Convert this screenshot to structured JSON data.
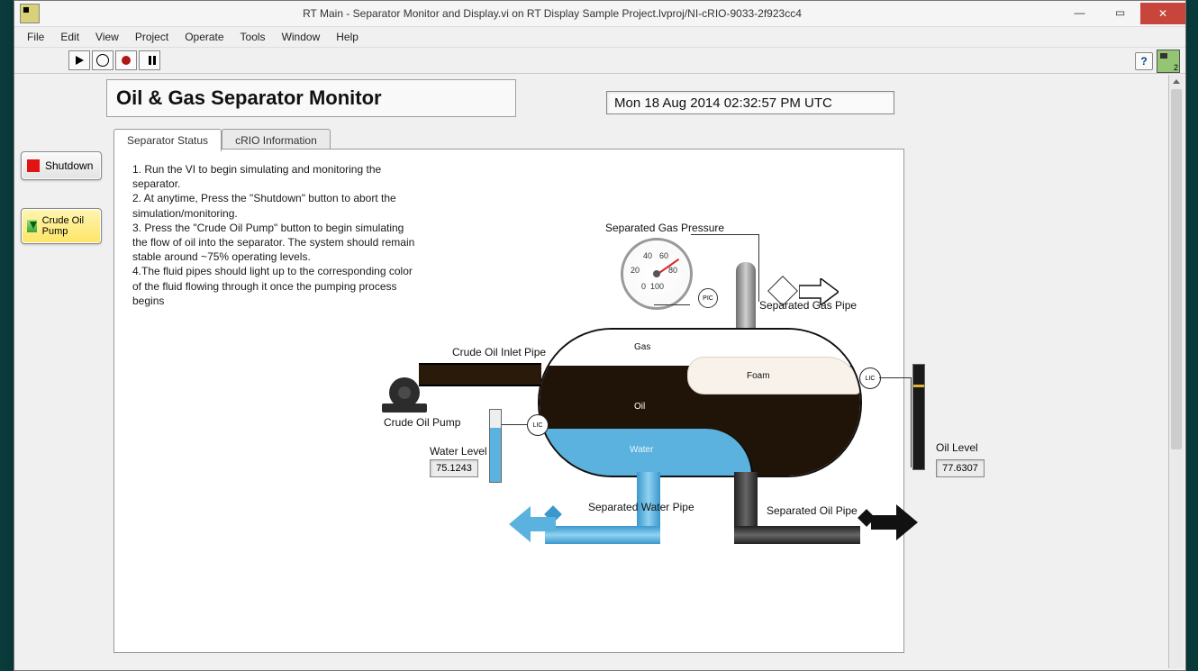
{
  "window": {
    "title": "RT Main - Separator Monitor and Display.vi on RT Display Sample Project.lvproj/NI-cRIO-9033-2f923cc4"
  },
  "menus": [
    "File",
    "Edit",
    "View",
    "Project",
    "Operate",
    "Tools",
    "Window",
    "Help"
  ],
  "header": {
    "title": "Oil & Gas Separator Monitor",
    "timestamp": "Mon 18 Aug 2014 02:32:57 PM UTC"
  },
  "side": {
    "shutdown": "Shutdown",
    "pump": "Crude Oil Pump"
  },
  "tabs": {
    "status": "Separator Status",
    "crio": "cRIO Information"
  },
  "instructions": {
    "l1": "1. Run the VI to begin simulating and monitoring the separator.",
    "l2": "2. At anytime, Press the \"Shutdown\" button to abort the simulation/monitoring.",
    "l3": "3. Press the \"Crude Oil Pump\" button to begin simulating the flow of oil into the separator. The system should remain stable around ~75% operating levels.",
    "l4": "4.The fluid pipes should light up to the corresponding color of the fluid flowing through it once the pumping process begins"
  },
  "diagram": {
    "gauge_label": "Separated Gas Pressure",
    "gauge_ticks": {
      "t0": "0",
      "t20": "20",
      "t40": "40",
      "t60": "60",
      "t80": "80",
      "t100": "100"
    },
    "pic": "PIC",
    "gas_pipe": "Separated Gas Pipe",
    "inlet": "Crude Oil Inlet Pipe",
    "pump": "Crude Oil Pump",
    "lic": "LIC",
    "water_level_label": "Water Level",
    "water_level_value": "75.1243",
    "oil_level_label": "Oil Level",
    "oil_level_value": "77.6307",
    "sep_water_pipe": "Separated Water Pipe",
    "sep_oil_pipe": "Separated Oil Pipe",
    "vessel": {
      "gas": "Gas",
      "foam": "Foam",
      "oil": "Oil",
      "water": "Water"
    }
  }
}
